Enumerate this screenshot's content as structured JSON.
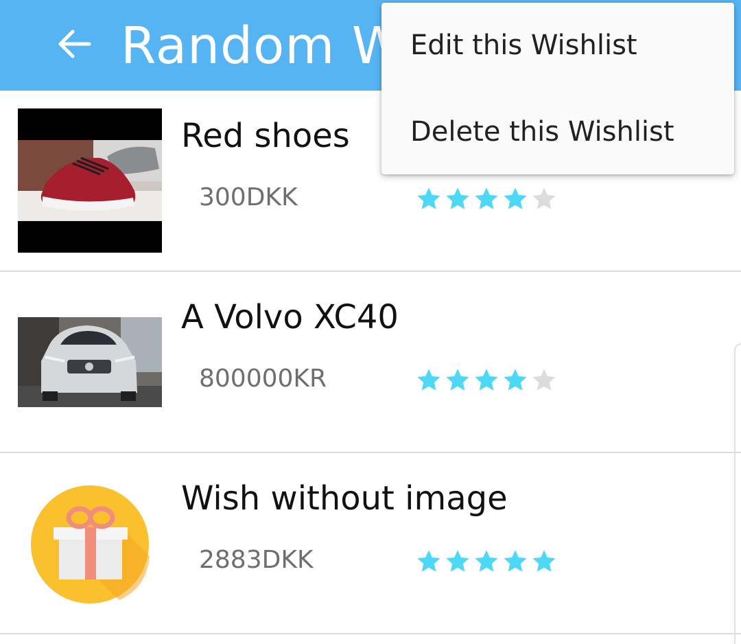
{
  "appbar": {
    "title": "Random Wishlist",
    "back_icon": "arrow-left-icon",
    "color": "#56b4f3"
  },
  "menu": {
    "items": [
      {
        "label": "Edit this Wishlist"
      },
      {
        "label": "Delete this Wishlist"
      }
    ]
  },
  "wishes": [
    {
      "title": "Red shoes",
      "price": "300DKK",
      "rating": 4,
      "max_rating": 5,
      "image": "red-shoes-photo"
    },
    {
      "title": "A Volvo XC40",
      "price": "800000KR",
      "rating": 4,
      "max_rating": 5,
      "image": "volvo-xc40-photo"
    },
    {
      "title": "Wish without image",
      "price": "2883DKK",
      "rating": 5,
      "max_rating": 5,
      "image": "gift-placeholder-icon"
    }
  ],
  "colors": {
    "star_filled": "#4dd9f5",
    "star_empty": "#dcdcdc",
    "gift_circle": "#fbc02d"
  }
}
